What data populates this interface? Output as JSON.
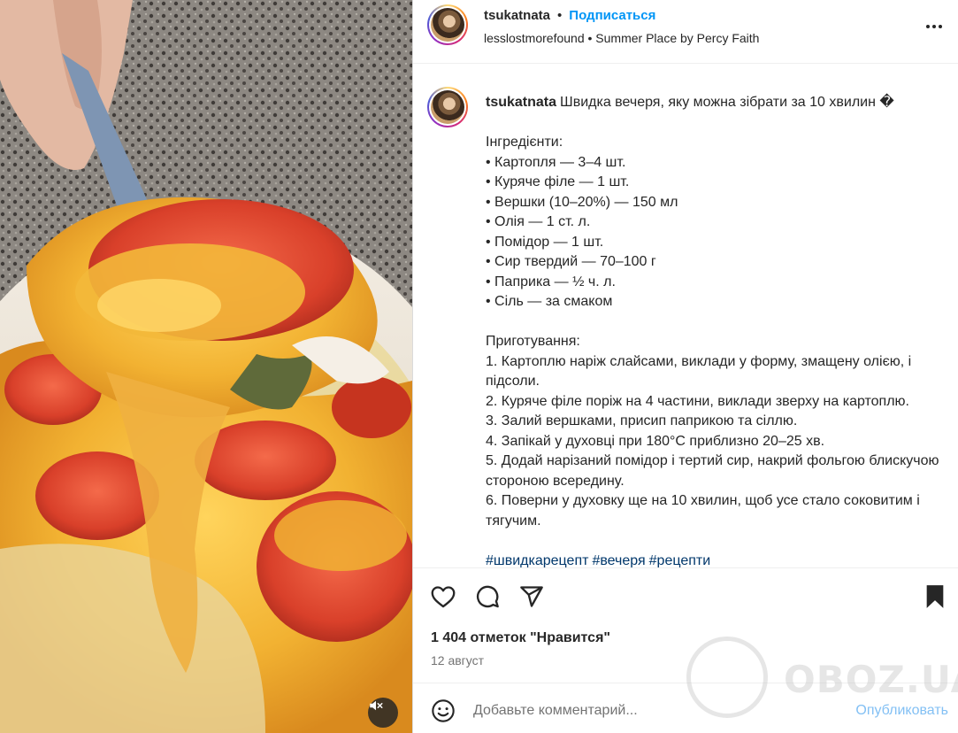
{
  "post": {
    "author": "tsukatnata",
    "follow_label": "Подписаться",
    "separator": "•",
    "audio_attribution": "lesslostmorefound • Summer Place by Percy Faith"
  },
  "caption": {
    "author": "tsukatnata",
    "lines": [
      "Швидка вечеря, яку можна зібрати за 10 хвилин �",
      "",
      "Інгредієнти:",
      "• Картопля — 3–4 шт.",
      "• Куряче філе — 1 шт.",
      "• Вершки (10–20%) — 150 мл",
      "• Олія — 1 ст. л.",
      "• Помідор — 1 шт.",
      "• Сир твердий — 70–100 г",
      "• Паприка — ½ ч. л.",
      "• Сіль — за смаком",
      "",
      "Приготування:",
      "1. Картоплю наріж слайсами, виклади у форму, змащену олією, і підсоли.",
      "2. Куряче філе поріж на 4 частини, виклади зверху на картоплю.",
      "3. Залий вершками, присип паприкою та сіллю.",
      "4. Запікай у духовці при 180°C приблизно 20–25 хв.",
      "5. Додай нарізаний помідор і тертий сир, накрий фольгою блискучою стороною всередину.",
      "6. Поверни у духовку ще на 10 хвилин, щоб усе стало соковитим і тягучим.",
      ""
    ],
    "hashtags": [
      "#швидкарецепт",
      "#вечеря",
      "#рецепти"
    ]
  },
  "actions": {
    "likes": "1 404 отметок \"Нравится\"",
    "date": "12 август"
  },
  "comment": {
    "placeholder": "Добавьте комментарий...",
    "publish_label": "Опубликовать"
  },
  "watermark": {
    "text": "OBOZ.UA"
  },
  "icons": {
    "more": "more-horizontal-icon",
    "like": "heart-icon",
    "comment": "comment-bubble-icon",
    "share": "paper-plane-icon",
    "save": "bookmark-icon",
    "emoji": "smiley-icon",
    "mute": "speaker-muted-icon"
  }
}
